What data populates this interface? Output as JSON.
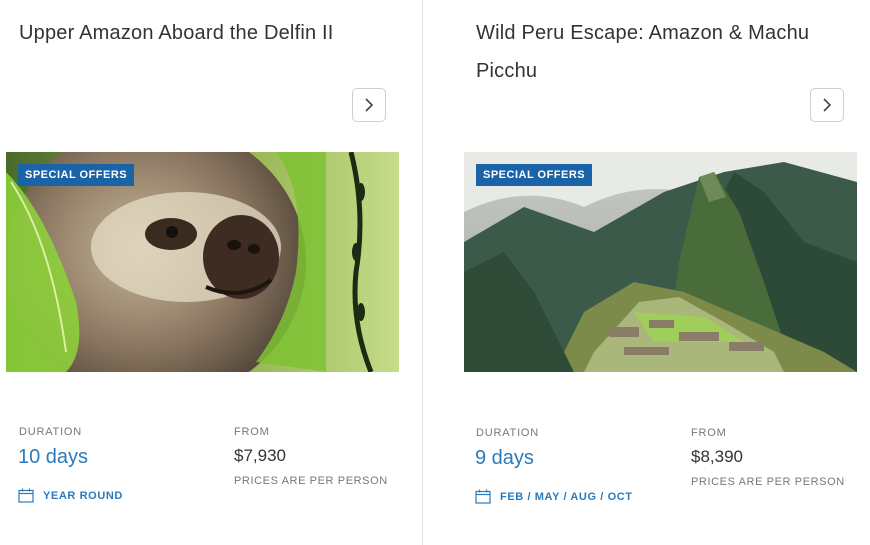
{
  "cards": [
    {
      "title": "Upper Amazon Aboard the Delfin II",
      "badge": "SPECIAL OFFERS",
      "duration_label": "DURATION",
      "duration": "10 days",
      "from_label": "FROM",
      "price": "$7,930",
      "price_note": "PRICES ARE PER PERSON",
      "season": "YEAR ROUND",
      "arrow_icon": "chevron-right-icon",
      "calendar_icon": "calendar-icon"
    },
    {
      "title": "Wild Peru Escape: Amazon & Machu Picchu",
      "badge": "SPECIAL OFFERS",
      "duration_label": "DURATION",
      "duration": "9 days",
      "from_label": "FROM",
      "price": "$8,390",
      "price_note": "PRICES ARE PER PERSON",
      "season": "FEB / MAY / AUG / OCT",
      "arrow_icon": "chevron-right-icon",
      "calendar_icon": "calendar-icon"
    }
  ],
  "colors": {
    "accent": "#2a7bbd",
    "badge_bg": "#1a63a6",
    "divider": "#dedede"
  }
}
